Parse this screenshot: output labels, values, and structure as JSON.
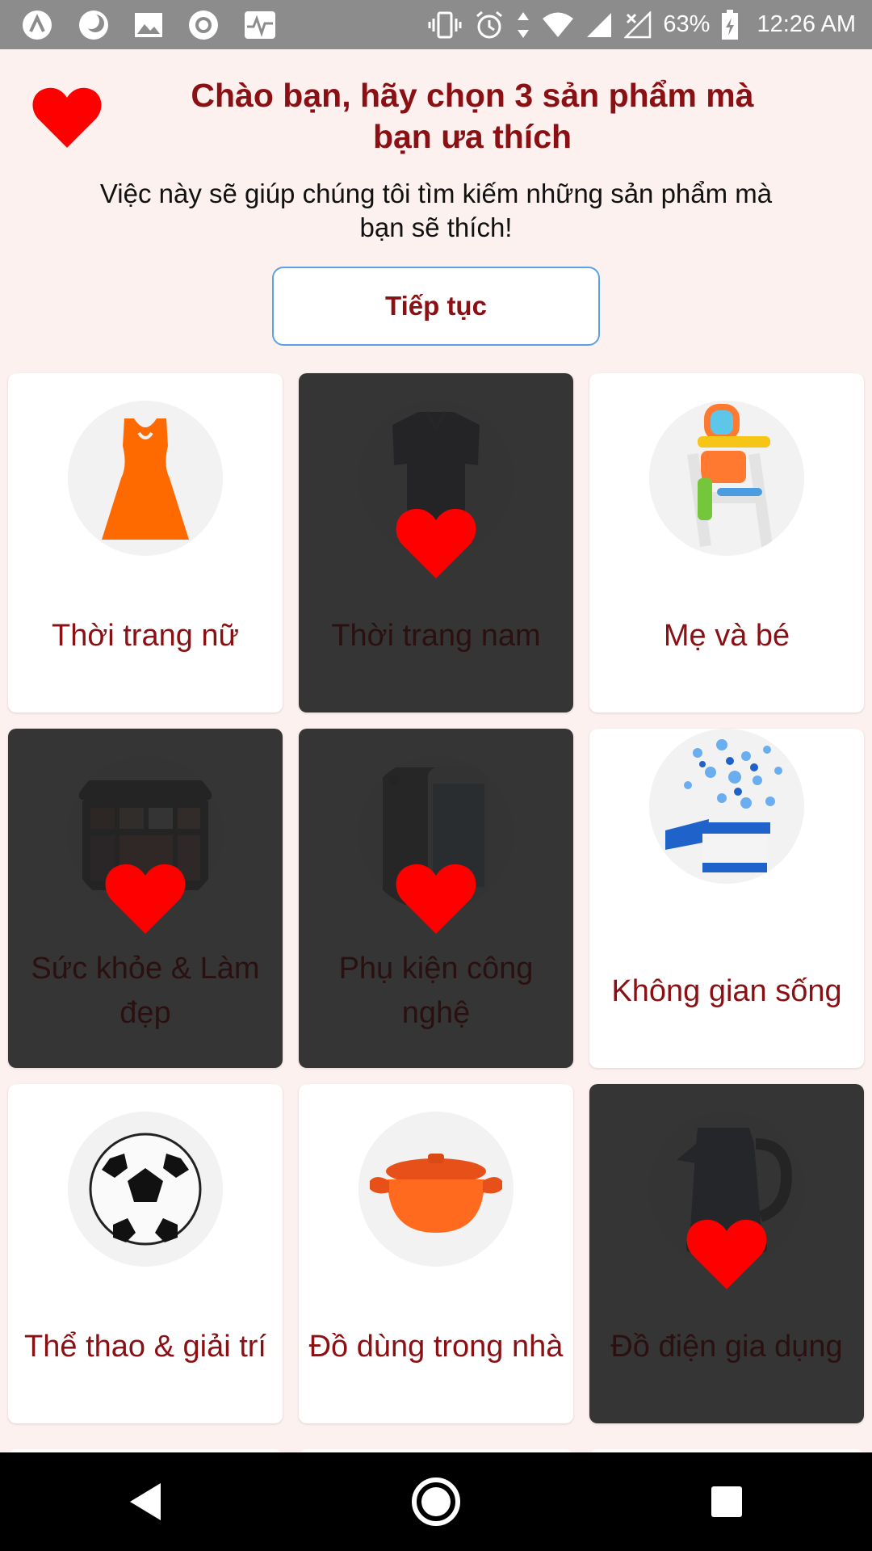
{
  "status_bar": {
    "battery": "63%",
    "time": "12:26 AM",
    "left_icons": [
      "app-icon",
      "moon-icon",
      "image-icon",
      "record-icon",
      "activity-icon"
    ],
    "right_icons": [
      "vibrate-icon",
      "alarm-icon",
      "data-arrows-icon",
      "wifi-icon",
      "signal-icon",
      "signal-off-icon",
      "battery-charging-icon"
    ]
  },
  "header": {
    "title": "Chào bạn, hãy chọn 3 sản phẩm mà bạn ưa thích",
    "subtitle": "Việc này sẽ giúp chúng tôi tìm kiếm những sản phẩm mà bạn sẽ thích!",
    "continue_label": "Tiếp tục"
  },
  "categories": [
    {
      "label": "Thời trang nữ",
      "icon": "dress-icon",
      "selected": false
    },
    {
      "label": "Thời trang nam",
      "icon": "polo-shirt-icon",
      "selected": true
    },
    {
      "label": "Mẹ và bé",
      "icon": "high-chair-icon",
      "selected": false
    },
    {
      "label": "Sức khỏe & Làm đẹp",
      "icon": "makeup-palette-icon",
      "selected": true
    },
    {
      "label": "Phụ kiện công nghệ",
      "icon": "phone-icon",
      "selected": true
    },
    {
      "label": "Không gian sống",
      "icon": "gift-box-icon",
      "selected": false
    },
    {
      "label": "Thể thao & giải trí",
      "icon": "soccer-ball-icon",
      "selected": false
    },
    {
      "label": "Đồ dùng trong nhà",
      "icon": "pot-icon",
      "selected": false
    },
    {
      "label": "Đồ điện gia dụng",
      "icon": "kettle-icon",
      "selected": true
    }
  ],
  "colors": {
    "accent": "#8b1014",
    "heart": "#ff0000",
    "background": "#fdf1ef",
    "button_border": "#5aa2e6",
    "selected_overlay": "#262626"
  },
  "nav_bar": {
    "icons": [
      "back-icon",
      "home-icon",
      "recents-icon"
    ]
  }
}
